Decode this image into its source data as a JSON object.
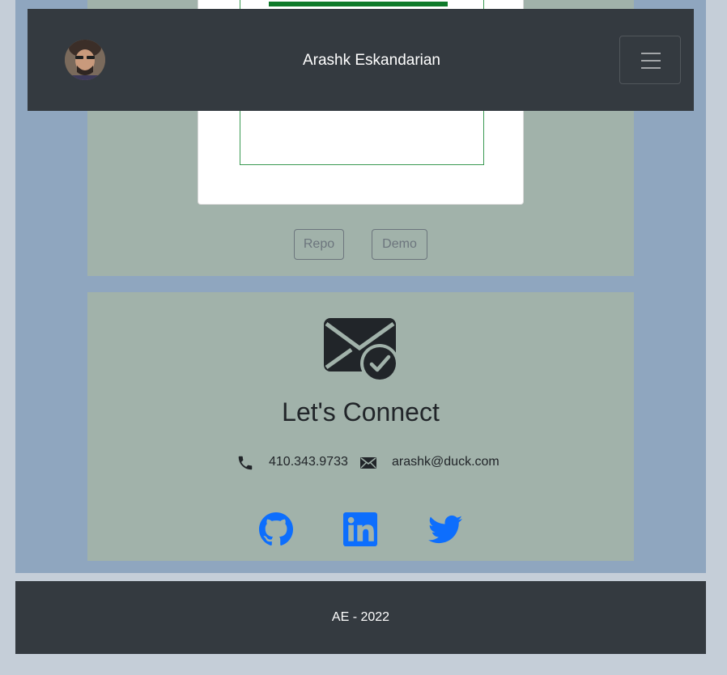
{
  "navbar": {
    "brand": "Arashk Eskandarian",
    "avatar_alt": "profile photo",
    "toggler_icon": "hamburger-icon"
  },
  "project": {
    "repo_label": "Repo",
    "demo_label": "Demo"
  },
  "contact": {
    "title": "Let's Connect",
    "phone": "410.343.9733",
    "email": "arashk@duck.com",
    "icons": [
      "mail-check-icon",
      "phone-icon",
      "envelope-icon"
    ],
    "social": [
      "github-icon",
      "linkedin-icon",
      "twitter-icon"
    ],
    "social_color": "#0d6efd"
  },
  "footer": {
    "text": "AE - 2022"
  }
}
